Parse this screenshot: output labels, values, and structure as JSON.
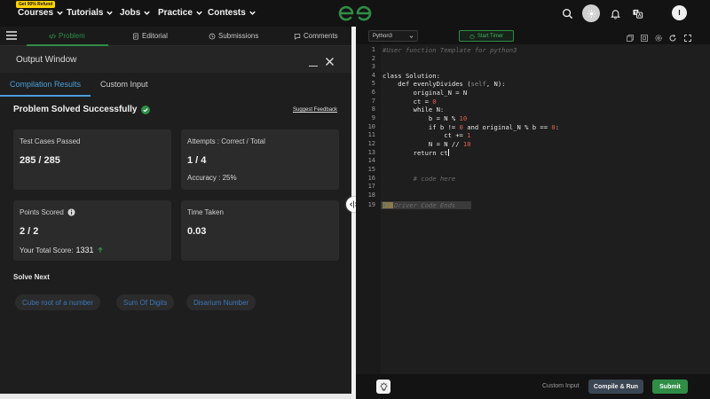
{
  "nav": {
    "promo": "Get 90% Refund",
    "items": [
      {
        "label": "Courses"
      },
      {
        "label": "Tutorials"
      },
      {
        "label": "Jobs"
      },
      {
        "label": "Practice"
      },
      {
        "label": "Contests"
      }
    ],
    "avatar": "I"
  },
  "problem_tabs": [
    {
      "label": "Problem",
      "active": true
    },
    {
      "label": "Editorial"
    },
    {
      "label": "Submissions"
    },
    {
      "label": "Comments"
    }
  ],
  "output": {
    "title": "Output Window",
    "tabs": [
      {
        "label": "Compilation Results",
        "active": true
      },
      {
        "label": "Custom Input"
      }
    ],
    "status": "Problem Solved Successfully",
    "feedback": "Suggest Feedback",
    "cards": {
      "tests_label": "Test Cases Passed",
      "tests_value": "285 / 285",
      "attempts_label": "Attempts : Correct / Total",
      "attempts_value": "1 / 4",
      "accuracy": "Accuracy : 25%",
      "points_label": "Points Scored",
      "points_value": "2 / 2",
      "total_score_label": "Your Total Score:",
      "total_score_value": "1331",
      "time_label": "Time Taken",
      "time_value": "0.03"
    },
    "solve_next_title": "Solve Next",
    "solve_next": [
      "Cube root of a number",
      "Sum Of Digits",
      "Disarium Number"
    ]
  },
  "editor": {
    "language": "Python3",
    "timer_label": "Start Timer",
    "line_numbers": [
      "1",
      "2",
      "3",
      "4",
      "5",
      "6",
      "7",
      "8",
      "9",
      "10",
      "11",
      "12",
      "13",
      "14",
      "15",
      "16",
      "17",
      "18",
      "19"
    ],
    "custom_input": "Custom Input",
    "compile_label": "Compile & Run",
    "submit_label": "Submit"
  },
  "colors": {
    "accent_green": "#2f8d46",
    "accent_blue": "#4a9edb"
  }
}
